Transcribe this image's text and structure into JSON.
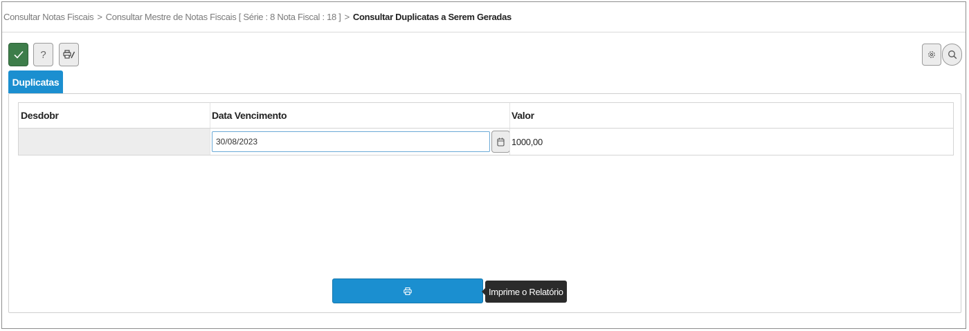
{
  "breadcrumb": {
    "items": [
      "Consultar Notas Fiscais",
      "Consultar Mestre de Notas Fiscais [ Série : 8 Nota Fiscal : 18 ]"
    ],
    "separator": ">",
    "current": "Consultar Duplicatas a Serem Geradas"
  },
  "toolbar": {
    "confirm_icon": "check-icon",
    "help_label": "?",
    "print_tool_icon": "printer-edit-icon",
    "settings_icon": "gear-icon",
    "search_icon": "search-icon"
  },
  "tab": {
    "label": "Duplicatas"
  },
  "grid": {
    "columns": [
      "Desdobr",
      "Data Vencimento",
      "Valor"
    ],
    "rows": [
      {
        "desdobr": "",
        "data_vencimento": "30/08/2023",
        "valor": "1000,00"
      }
    ]
  },
  "print_button": {
    "icon": "printer-icon",
    "tooltip": "Imprime o Relatório"
  },
  "colors": {
    "accent": "#1b8fd0",
    "confirm": "#3d7d4a",
    "tooltip_bg": "#2b2b2b"
  }
}
